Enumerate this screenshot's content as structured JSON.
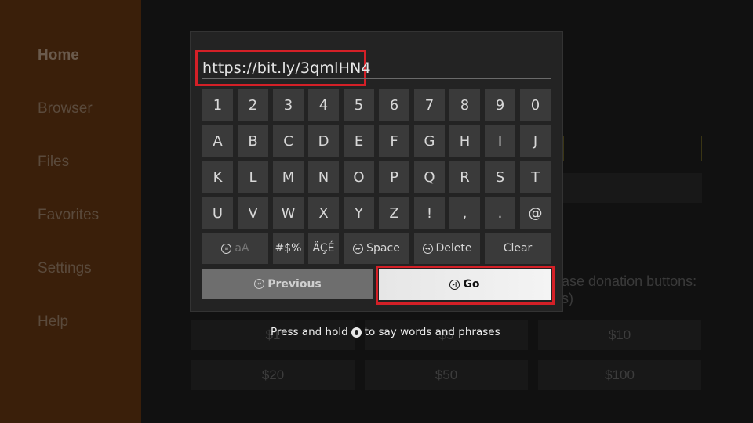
{
  "sidebar": {
    "items": [
      {
        "label": "Home",
        "active": true
      },
      {
        "label": "Browser"
      },
      {
        "label": "Files"
      },
      {
        "label": "Favorites"
      },
      {
        "label": "Settings"
      },
      {
        "label": "Help"
      }
    ]
  },
  "background": {
    "donation_text_line1": "ase donation buttons:",
    "donation_text_line2": "s)",
    "donation_buttons": [
      "$1",
      "$5",
      "$10",
      "$20",
      "$50",
      "$100"
    ]
  },
  "keyboard": {
    "url_value": "https://bit.ly/3qmlHN4",
    "rows": [
      [
        "1",
        "2",
        "3",
        "4",
        "5",
        "6",
        "7",
        "8",
        "9",
        "0"
      ],
      [
        "A",
        "B",
        "C",
        "D",
        "E",
        "F",
        "G",
        "H",
        "I",
        "J"
      ],
      [
        "K",
        "L",
        "M",
        "N",
        "O",
        "P",
        "Q",
        "R",
        "S",
        "T"
      ],
      [
        "U",
        "V",
        "W",
        "X",
        "Y",
        "Z",
        "!",
        ",",
        ".",
        "@"
      ]
    ],
    "function_keys": {
      "case_toggle": "aA",
      "symbols": "#$%",
      "accents": "ÄÇÉ",
      "space": "Space",
      "delete": "Delete",
      "clear": "Clear"
    },
    "previous_label": "Previous",
    "go_label": "Go",
    "voice_hint_before": "Press and hold",
    "voice_hint_after": "to say words and phrases"
  },
  "colors": {
    "highlight": "#d42027",
    "sidebar_bg": "#3a1f0a"
  }
}
